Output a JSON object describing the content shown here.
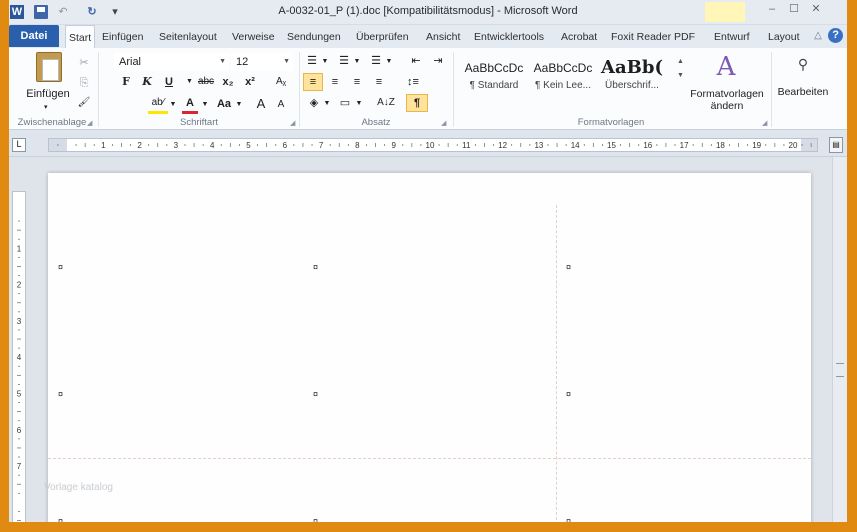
{
  "window": {
    "title": "A-0032-01_P (1).doc [Kompatibilitätsmodus] - Microsoft Word",
    "app_icon_letter": "W",
    "undo_symbol": "↶",
    "redo_symbol": "↻",
    "qa_more_symbol": "▾",
    "controls": [
      "–",
      "☐",
      "✕"
    ]
  },
  "tabs": {
    "file": "Datei",
    "items": [
      "Start",
      "Einfügen",
      "Seitenlayout",
      "Verweise",
      "Sendungen",
      "Überprüfen",
      "Ansicht",
      "Entwicklertools",
      "Acrobat",
      "Foxit Reader PDF",
      "Entwurf",
      "Layout"
    ],
    "active": "Start",
    "help_symbol": "?",
    "collapse_symbol": "△"
  },
  "clipboard": {
    "paste_label": "Einfügen",
    "paste_arrow": "▾",
    "cut_symbol": "✂",
    "copy_symbol": "⎘",
    "format_painter_symbol": "🖌",
    "group_label": "Zwischenablage"
  },
  "font": {
    "family": "Arial",
    "size": "12",
    "bold": "F",
    "italic": "K",
    "underline": "U",
    "strike": "abc",
    "subscript": "x₂",
    "superscript": "x²",
    "clear_format": "Aᵪ",
    "highlight": "ab⁄",
    "font_color": "A",
    "change_case": "Aa",
    "grow": "A",
    "shrink": "A",
    "group_label": "Schriftart"
  },
  "paragraph": {
    "bullets": "☰",
    "numbering": "☰",
    "multilevel": "☰",
    "outdent": "⇤",
    "indent": "⇥",
    "align_left": "≡",
    "center": "≡",
    "align_right": "≡",
    "justify": "≡",
    "line_spacing": "↕≡",
    "shading": "◈",
    "borders": "▭",
    "sort": "A↓Z",
    "show_marks": "¶",
    "group_label": "Absatz"
  },
  "styles": {
    "tiles": [
      {
        "sample": "AaBbCcDc",
        "name": "¶ Standard"
      },
      {
        "sample": "AaBbCcDc",
        "name": "¶ Kein Lee..."
      },
      {
        "sample": "AaBb(",
        "name": "Überschrif..."
      }
    ],
    "change_icon": "A",
    "change_label_line1": "Formatvorlagen",
    "change_label_line2": "ändern",
    "group_label": "Formatvorlagen"
  },
  "editing": {
    "icon": "⚲",
    "label": "Bearbeiten"
  },
  "ruler": {
    "tab_selector": "L",
    "h_numbers": [
      "1",
      "2",
      "3",
      "4",
      "5",
      "6",
      "7",
      "8",
      "9",
      "10",
      "11",
      "12",
      "13",
      "14",
      "15",
      "16",
      "17",
      "18",
      "19",
      "20"
    ],
    "v_numbers": [
      "1",
      "2",
      "3",
      "4",
      "5",
      "6",
      "7"
    ]
  },
  "document": {
    "cell_marker": "¤",
    "watermark": "Vorlage katalog"
  }
}
